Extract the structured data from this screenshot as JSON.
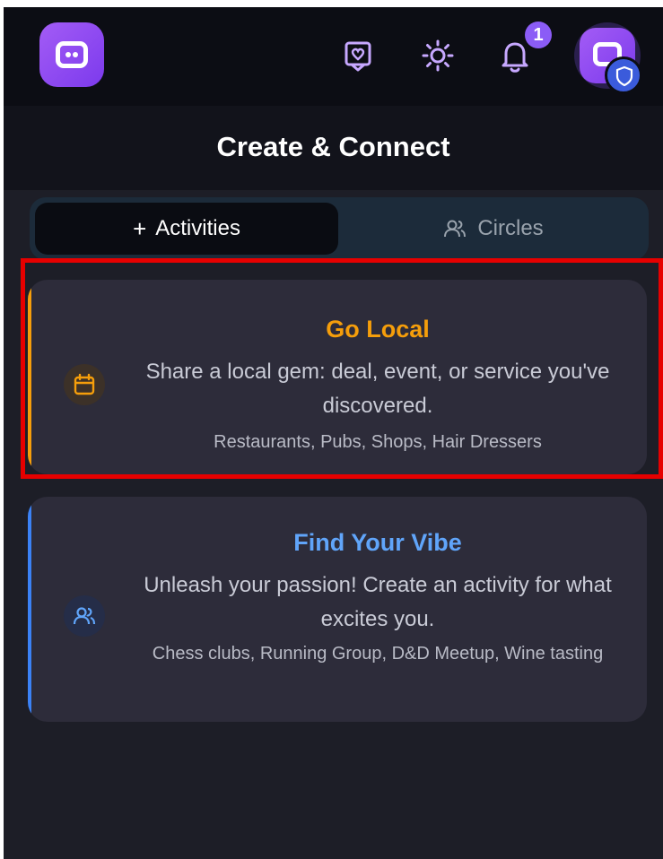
{
  "header": {
    "title": "Create & Connect",
    "notification_count": "1"
  },
  "tabs": [
    {
      "label": "Activities",
      "active": true,
      "icon": "plus-icon"
    },
    {
      "label": "Circles",
      "active": false,
      "icon": "users-icon"
    }
  ],
  "cards": [
    {
      "title": "Go Local",
      "description": "Share a local gem: deal, event, or service you've discovered.",
      "examples": "Restaurants, Pubs, Shops, Hair Dressers",
      "icon": "calendar-icon",
      "accent_color": "#f59e0b"
    },
    {
      "title": "Find Your Vibe",
      "description": "Unleash your passion! Create an activity for what excites you.",
      "examples": "Chess clubs, Running Group, D&D Meetup, Wine tasting",
      "icon": "users-icon",
      "accent_color": "#3b82f6"
    }
  ],
  "colors": {
    "brand": "#8b5cf6",
    "highlight": "#e60000",
    "background": "#1d1e27"
  }
}
